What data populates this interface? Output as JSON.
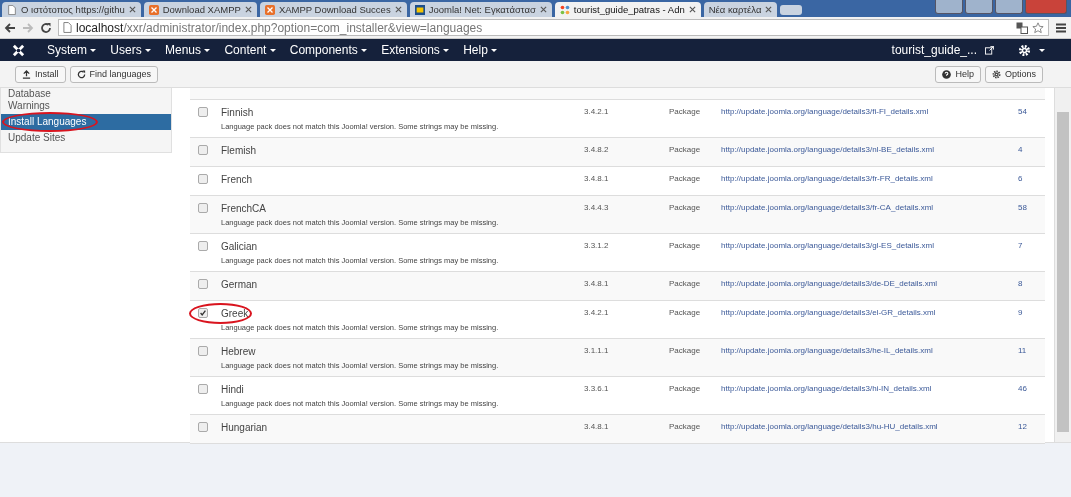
{
  "browser": {
    "tabs": [
      {
        "title": "Ο ιστότοπος https://githu",
        "kind": "page",
        "selected": false
      },
      {
        "title": "Download XAMPP",
        "kind": "xampp",
        "selected": false
      },
      {
        "title": "XAMPP Download Succes",
        "kind": "xampp",
        "selected": false
      },
      {
        "title": "Joomla! Net: Εγκατάστασ",
        "kind": "joomlanet",
        "selected": false
      },
      {
        "title": "tourist_guide_patras - Adn",
        "kind": "joomla",
        "selected": true
      },
      {
        "title": "Νέα καρτέλα",
        "kind": "blank",
        "selected": false
      }
    ],
    "address": {
      "host": "localhost",
      "path": "/xxr/administrator/index.php?option=com_installer&view=languages"
    }
  },
  "navbar": {
    "menus": [
      "System",
      "Users",
      "Menus",
      "Content",
      "Components",
      "Extensions",
      "Help"
    ],
    "site": "tourist_guide_..."
  },
  "toolbar": {
    "left": [
      {
        "label": "Install",
        "kind": "upload"
      },
      {
        "label": "Find languages",
        "kind": "refresh"
      }
    ],
    "right": [
      {
        "label": "Help",
        "kind": "help"
      },
      {
        "label": "Options",
        "kind": "options"
      }
    ]
  },
  "sidebar": {
    "items": [
      {
        "label": "Database",
        "selected": false,
        "circled": false
      },
      {
        "label": "Warnings",
        "selected": false,
        "circled": false
      },
      {
        "label": "Install Languages",
        "selected": true,
        "circled": true
      },
      {
        "label": "Update Sites",
        "selected": false,
        "circled": false
      }
    ]
  },
  "table": {
    "rows": [
      {
        "name": "Finnish",
        "note": "Language pack does not match this Joomla! version. Some strings may be missing.",
        "version": "3.4.2.1",
        "type": "Package",
        "url": "http://update.joomla.org/language/details3/fi-FI_details.xml",
        "id": "54",
        "checked": false,
        "circled": false
      },
      {
        "name": "Flemish",
        "version": "3.4.8.2",
        "type": "Package",
        "url": "http://update.joomla.org/language/details3/nl-BE_details.xml",
        "id": "4",
        "checked": false,
        "circled": false
      },
      {
        "name": "French",
        "version": "3.4.8.1",
        "type": "Package",
        "url": "http://update.joomla.org/language/details3/fr-FR_details.xml",
        "id": "6",
        "checked": false,
        "circled": false
      },
      {
        "name": "FrenchCA",
        "note": "Language pack does not match this Joomla! version. Some strings may be missing.",
        "version": "3.4.4.3",
        "type": "Package",
        "url": "http://update.joomla.org/language/details3/fr-CA_details.xml",
        "id": "58",
        "checked": false,
        "circled": false
      },
      {
        "name": "Galician",
        "note": "Language pack does not match this Joomla! version. Some strings may be missing.",
        "version": "3.3.1.2",
        "type": "Package",
        "url": "http://update.joomla.org/language/details3/gl-ES_details.xml",
        "id": "7",
        "checked": false,
        "circled": false
      },
      {
        "name": "German",
        "version": "3.4.8.1",
        "type": "Package",
        "url": "http://update.joomla.org/language/details3/de-DE_details.xml",
        "id": "8",
        "checked": false,
        "circled": false
      },
      {
        "name": "Greek",
        "note": "Language pack does not match this Joomla! version. Some strings may be missing.",
        "version": "3.4.2.1",
        "type": "Package",
        "url": "http://update.joomla.org/language/details3/el-GR_details.xml",
        "id": "9",
        "checked": true,
        "circled": true
      },
      {
        "name": "Hebrew",
        "note": "Language pack does not match this Joomla! version. Some strings may be missing.",
        "version": "3.1.1.1",
        "type": "Package",
        "url": "http://update.joomla.org/language/details3/he-IL_details.xml",
        "id": "11",
        "checked": false,
        "circled": false
      },
      {
        "name": "Hindi",
        "note": "Language pack does not match this Joomla! version. Some strings may be missing.",
        "version": "3.3.6.1",
        "type": "Package",
        "url": "http://update.joomla.org/language/details3/hi-IN_details.xml",
        "id": "46",
        "checked": false,
        "circled": false
      },
      {
        "name": "Hungarian",
        "version": "3.4.8.1",
        "type": "Package",
        "url": "http://update.joomla.org/language/details3/hu-HU_details.xml",
        "id": "12",
        "checked": false,
        "circled": false
      }
    ]
  }
}
